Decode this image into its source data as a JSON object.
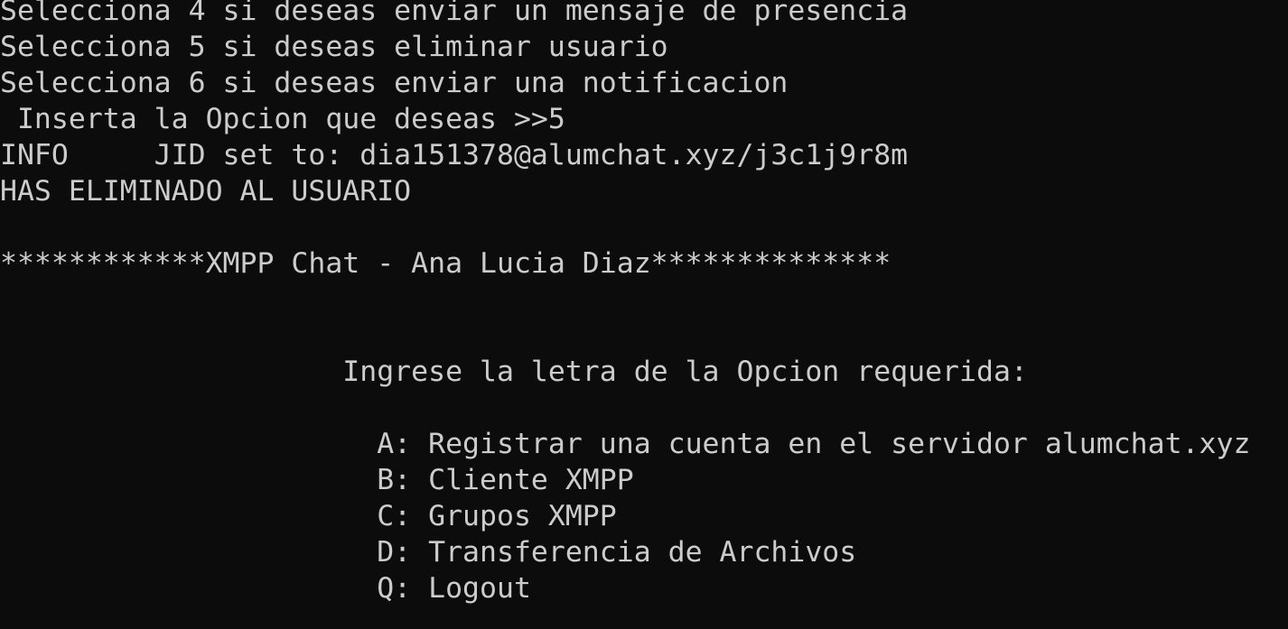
{
  "terminal": {
    "colors": {
      "background": "#0c0c0c",
      "foreground": "#cccccc"
    },
    "lines": [
      "Selecciona 4 si deseas enviar un mensaje de presencia",
      "Selecciona 5 si deseas eliminar usuario",
      "Selecciona 6 si deseas enviar una notificacion",
      " Inserta la Opcion que deseas >>5",
      "INFO     JID set to: dia151378@alumchat.xyz/j3c1j9r8m",
      "HAS ELIMINADO AL USUARIO",
      "",
      "************XMPP Chat - Ana Lucia Diaz**************",
      "",
      "",
      "                    Ingrese la letra de la Opcion requerida:",
      "",
      "                      A: Registrar una cuenta en el servidor alumchat.xyz",
      "                      B: Cliente XMPP",
      "                      C: Grupos XMPP",
      "                      D: Transferencia de Archivos",
      "                      Q: Logout"
    ]
  }
}
